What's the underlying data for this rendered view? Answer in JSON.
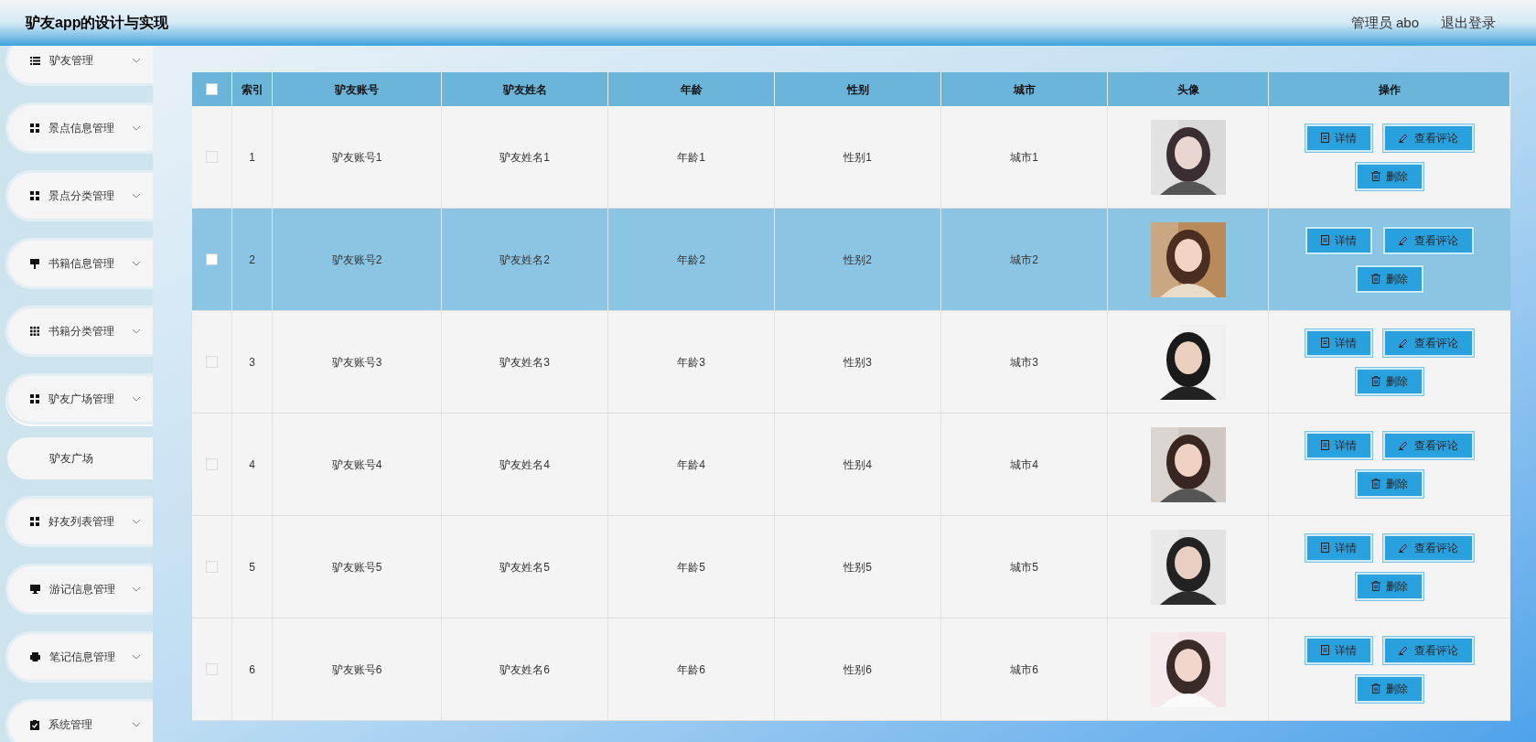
{
  "header": {
    "title": "驴友app的设计与实现",
    "user": "管理员 abo",
    "logout": "退出登录"
  },
  "sidebar": {
    "items": [
      {
        "label": "驴友管理",
        "expanded": false
      },
      {
        "label": "景点信息管理",
        "expanded": false
      },
      {
        "label": "景点分类管理",
        "expanded": false
      },
      {
        "label": "书籍信息管理",
        "expanded": false
      },
      {
        "label": "书籍分类管理",
        "expanded": false
      },
      {
        "label": "驴友广场管理",
        "expanded": true,
        "children": [
          {
            "label": "驴友广场"
          }
        ]
      },
      {
        "label": "好友列表管理",
        "expanded": false
      },
      {
        "label": "游记信息管理",
        "expanded": false
      },
      {
        "label": "笔记信息管理",
        "expanded": false
      },
      {
        "label": "系统管理",
        "expanded": false
      }
    ]
  },
  "table": {
    "select_all": {
      "checked": false
    },
    "columns": [
      "索引",
      "驴友账号",
      "驴友姓名",
      "年龄",
      "性别",
      "城市",
      "头像",
      "操作"
    ],
    "rows": [
      {
        "checked": false,
        "selected": false,
        "cells": [
          "1",
          "驴友账号1",
          "驴友姓名1",
          "年龄1",
          "性别1",
          "城市1"
        ],
        "actions": [
          "详情",
          "查看评论",
          "删除"
        ]
      },
      {
        "checked": false,
        "selected": true,
        "cells": [
          "2",
          "驴友账号2",
          "驴友姓名2",
          "年龄2",
          "性别2",
          "城市2"
        ],
        "actions": [
          "详情",
          "查看评论",
          "删除"
        ]
      },
      {
        "checked": false,
        "selected": false,
        "cells": [
          "3",
          "驴友账号3",
          "驴友姓名3",
          "年龄3",
          "性别3",
          "城市3"
        ],
        "actions": [
          "详情",
          "查看评论",
          "删除"
        ]
      },
      {
        "checked": false,
        "selected": false,
        "cells": [
          "4",
          "驴友账号4",
          "驴友姓名4",
          "年龄4",
          "性别4",
          "城市4"
        ],
        "actions": [
          "详情",
          "查看评论",
          "删除"
        ]
      },
      {
        "checked": false,
        "selected": false,
        "cells": [
          "5",
          "驴友账号5",
          "驴友姓名5",
          "年龄5",
          "性别5",
          "城市5"
        ],
        "actions": [
          "详情",
          "查看评论",
          "删除"
        ]
      },
      {
        "checked": false,
        "selected": false,
        "cells": [
          "6",
          "驴友账号6",
          "驴友姓名6",
          "年龄6",
          "性别6",
          "城市6"
        ],
        "actions": [
          "详情",
          "查看评论",
          "删除"
        ]
      }
    ]
  }
}
